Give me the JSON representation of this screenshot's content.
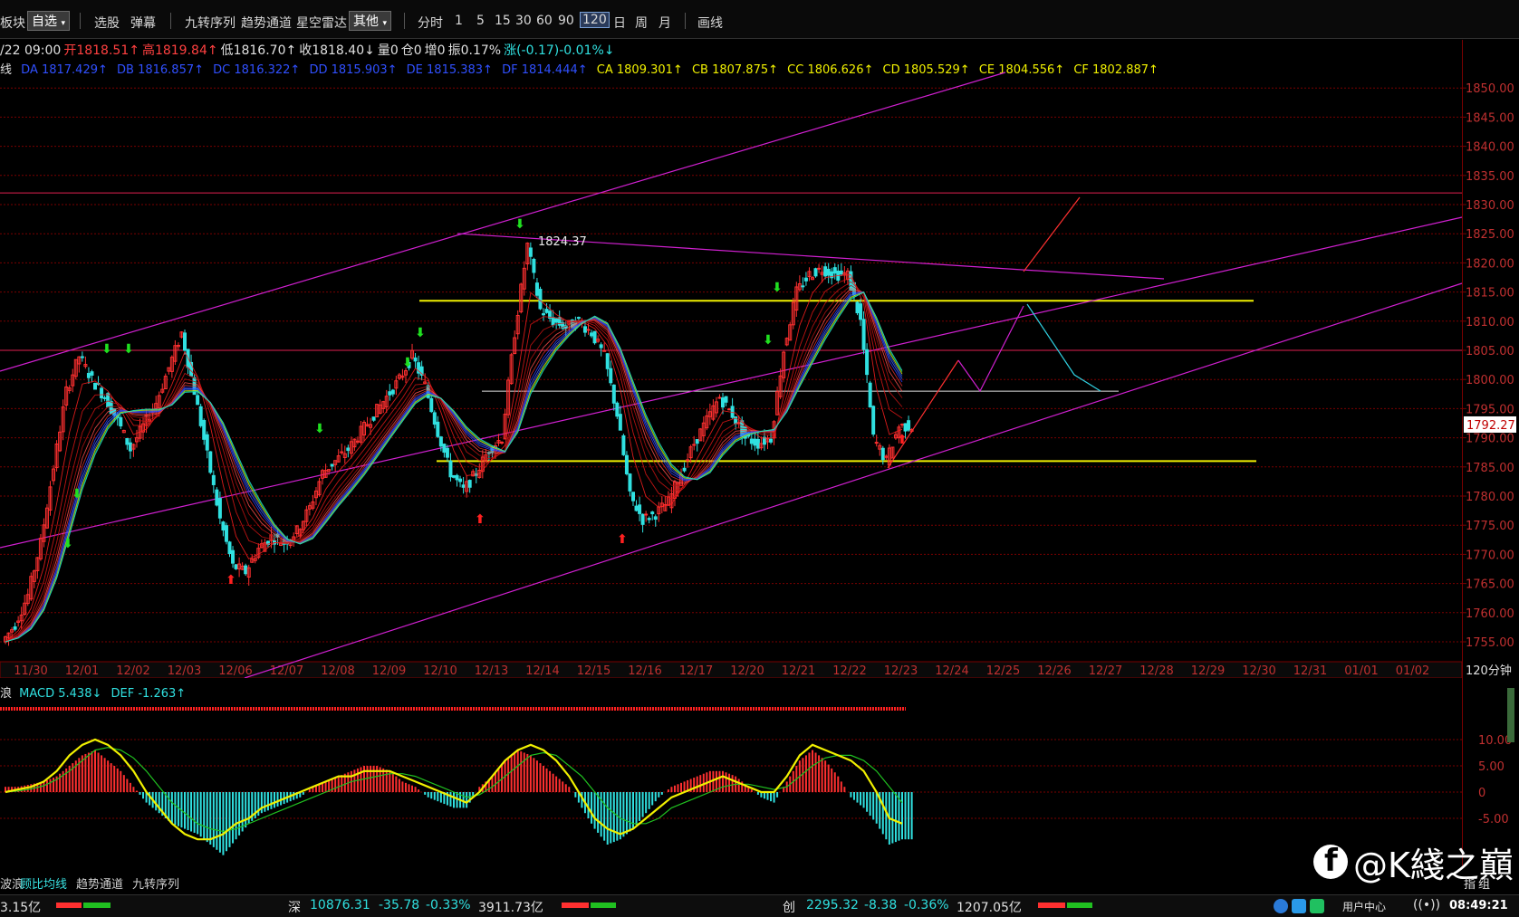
{
  "toolbar": {
    "items": [
      "板块",
      "自选",
      "选股",
      "弹幕",
      "九转序列",
      "趋势通道",
      "星空雷达",
      "其他"
    ],
    "periods": [
      "分时",
      "1",
      "5",
      "15",
      "30",
      "60",
      "90",
      "120",
      "日",
      "周",
      "月"
    ],
    "active_period": "120",
    "draw_label": "画线"
  },
  "info": {
    "date": "/22 09:00",
    "open": "开1818.51↑",
    "high": "高1819.84↑",
    "low": "低1816.70↑",
    "close": "收1818.40↓",
    "volume": "量0",
    "position": "仓0",
    "increase": "增0",
    "amplitude": "振0.17%",
    "change": "涨(-0.17)-0.01%↓"
  },
  "ma_line": {
    "prefix": "线",
    "items": [
      {
        "label": "DA 1817.429↑",
        "color": "#3050ff"
      },
      {
        "label": "DB 1816.857↑",
        "color": "#3050ff"
      },
      {
        "label": "DC 1816.322↑",
        "color": "#3050ff"
      },
      {
        "label": "DD 1815.903↑",
        "color": "#3050ff"
      },
      {
        "label": "DE 1815.383↑",
        "color": "#3050ff"
      },
      {
        "label": "DF 1814.444↑",
        "color": "#3050ff"
      },
      {
        "label": "CA 1809.301↑",
        "color": "#f0f000"
      },
      {
        "label": "CB 1807.875↑",
        "color": "#f0f000"
      },
      {
        "label": "CC 1806.626↑",
        "color": "#f0f000"
      },
      {
        "label": "CD 1805.529↑",
        "color": "#f0f000"
      },
      {
        "label": "CE 1804.556↑",
        "color": "#f0f000"
      },
      {
        "label": "CF 1802.887↑",
        "color": "#f0f000"
      }
    ]
  },
  "annotation_high": "1824.37",
  "current_price": "1792.27",
  "axis_period_label": "120分钟",
  "chart_data": [
    {
      "type": "candlestick",
      "title": "",
      "y_ticks": [
        1755,
        1760,
        1765,
        1770,
        1775,
        1780,
        1785,
        1790,
        1795,
        1800,
        1805,
        1810,
        1815,
        1820,
        1825,
        1830,
        1835,
        1840,
        1845,
        1850
      ],
      "ylim": [
        1751,
        1855
      ],
      "x_ticks": [
        "11/30",
        "12/01",
        "12/02",
        "12/03",
        "12/06",
        "12/07",
        "12/08",
        "12/09",
        "12/10",
        "12/13",
        "12/14",
        "12/15",
        "12/16",
        "12/17",
        "12/20",
        "12/21",
        "12/22",
        "12/23",
        "12/24",
        "12/25",
        "12/26",
        "12/27",
        "12/28",
        "12/29",
        "12/30",
        "12/31",
        "01/01",
        "01/02"
      ],
      "close_path": [
        1755,
        1758,
        1763,
        1772,
        1785,
        1798,
        1804,
        1800,
        1797,
        1793,
        1788,
        1792,
        1796,
        1802,
        1808,
        1798,
        1787,
        1776,
        1768,
        1767,
        1771,
        1773,
        1772,
        1774,
        1778,
        1784,
        1786,
        1788,
        1791,
        1794,
        1797,
        1800,
        1804,
        1799,
        1791,
        1784,
        1781,
        1784,
        1788,
        1790,
        1808,
        1823,
        1812,
        1810,
        1809,
        1810,
        1808,
        1804,
        1794,
        1780,
        1776,
        1777,
        1779,
        1784,
        1789,
        1793,
        1797,
        1794,
        1790,
        1789,
        1790,
        1805,
        1815,
        1818,
        1819,
        1818,
        1818,
        1810,
        1790,
        1786,
        1792
      ],
      "horizontal_levels": [
        1813.5,
        1805,
        1798,
        1786,
        1832
      ],
      "price_label": "1792.27"
    },
    {
      "type": "macd",
      "indicators": [
        "MACD 5.438↓",
        "DEF -1.263↑"
      ],
      "y_ticks": [
        -5.0,
        0,
        5.0,
        10.0
      ],
      "ylim": [
        -12,
        14
      ],
      "hist": [
        1,
        1,
        1.5,
        2,
        3,
        5,
        7,
        8,
        6,
        4,
        1,
        -2,
        -4,
        -6,
        -7,
        -8,
        -10,
        -12,
        -9,
        -6,
        -4,
        -3,
        -2,
        -1,
        1,
        2,
        3,
        4,
        5,
        5,
        4,
        2,
        1,
        -1,
        -2,
        -3,
        -3,
        1,
        3,
        6,
        8,
        7,
        5,
        3,
        1,
        -3,
        -7,
        -10,
        -9,
        -7,
        -4,
        -1,
        1,
        2,
        3,
        4,
        4,
        3,
        1,
        -1,
        -2,
        2,
        6,
        8,
        6,
        3,
        -1,
        -3,
        -6,
        -10,
        -9
      ],
      "dif": [
        0,
        0.5,
        1,
        2,
        4,
        7,
        9,
        10,
        9,
        7,
        4,
        0,
        -3,
        -6,
        -8,
        -9,
        -9,
        -8,
        -6,
        -5,
        -3,
        -2,
        -1,
        0,
        1,
        2,
        3,
        3,
        4,
        4,
        4,
        3,
        2,
        1,
        0,
        -1,
        -2,
        0,
        3,
        6,
        8,
        9,
        8,
        6,
        3,
        -1,
        -5,
        -7,
        -8,
        -7,
        -5,
        -3,
        -1,
        0,
        1,
        2,
        3,
        2,
        1,
        0,
        0,
        3,
        7,
        9,
        8,
        7,
        6,
        4,
        0,
        -5,
        -6
      ],
      "dea": [
        0,
        0.2,
        0.6,
        1.2,
        2.4,
        4,
        6,
        8,
        8.5,
        8,
        6.5,
        4,
        1,
        -2,
        -4,
        -6,
        -7,
        -7.5,
        -7,
        -6,
        -5,
        -4,
        -3,
        -2,
        -1,
        0,
        1,
        2,
        2.5,
        3,
        3.5,
        3.5,
        3,
        2,
        1,
        0,
        -1,
        -0.5,
        1,
        3,
        5,
        7,
        7.5,
        7,
        5,
        3,
        0,
        -3,
        -5,
        -6,
        -6,
        -5,
        -3,
        -2,
        -1,
        0,
        1,
        1.5,
        1.5,
        1,
        0.5,
        1,
        3,
        5,
        6.5,
        7,
        7,
        6,
        4,
        1,
        -2
      ]
    }
  ],
  "tabs": [
    "波浪",
    "顾比均线",
    "趋势通道",
    "九转序列"
  ],
  "active_tab": "顾比均线",
  "status": {
    "left_value": "3.15亿",
    "sz_label": "深",
    "sz_index": "10876.31",
    "sz_change": "-35.78",
    "sz_pct": "-0.33%",
    "sz_amount": "3911.73亿",
    "cy_label": "创",
    "cy_index": "2295.32",
    "cy_change": "-8.38",
    "cy_pct": "-0.36%",
    "cy_amount": "1207.05亿",
    "user_center": "用户中心",
    "time": "08:49:21",
    "misc": "指",
    "misc2": "组"
  },
  "watermark": "@K綫之巔",
  "colors": {
    "up": "#ff3030",
    "down": "#30e0e0",
    "grid": "#7a0000",
    "trend": "#d020d0",
    "support": "#f0f000",
    "axis_text": "#c03030",
    "arrow_down_signal": "#20e020",
    "arrow_up_signal": "#ff2020"
  }
}
